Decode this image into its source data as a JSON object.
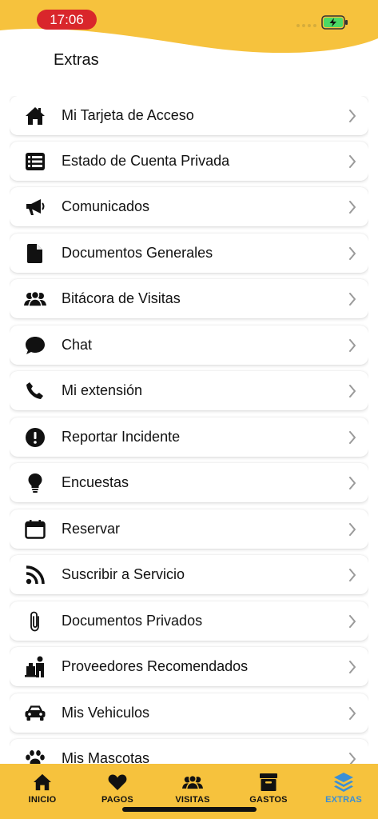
{
  "status_bar": {
    "time": "17:06"
  },
  "header": {
    "title": "Extras"
  },
  "menu": [
    {
      "label": "Mi Tarjeta de Acceso",
      "icon": "home-icon"
    },
    {
      "label": "Estado de Cuenta Privada",
      "icon": "list-icon"
    },
    {
      "label": "Comunicados",
      "icon": "megaphone-icon"
    },
    {
      "label": "Documentos Generales",
      "icon": "document-icon"
    },
    {
      "label": "Bitácora de Visitas",
      "icon": "users-icon"
    },
    {
      "label": "Chat",
      "icon": "chat-icon"
    },
    {
      "label": "Mi extensión",
      "icon": "phone-icon"
    },
    {
      "label": "Reportar Incidente",
      "icon": "alert-icon"
    },
    {
      "label": "Encuestas",
      "icon": "lightbulb-icon"
    },
    {
      "label": "Reservar",
      "icon": "calendar-icon"
    },
    {
      "label": "Suscribir a Servicio",
      "icon": "rss-icon"
    },
    {
      "label": "Documentos Privados",
      "icon": "paperclip-icon"
    },
    {
      "label": "Proveedores Recomendados",
      "icon": "supplier-icon"
    },
    {
      "label": "Mis Vehiculos",
      "icon": "car-icon"
    },
    {
      "label": "Mis Mascotas",
      "icon": "paw-icon"
    }
  ],
  "tabs": [
    {
      "label": "INICIO",
      "icon": "home-icon",
      "active": false
    },
    {
      "label": "PAGOS",
      "icon": "heart-icon",
      "active": false
    },
    {
      "label": "VISITAS",
      "icon": "users-icon",
      "active": false
    },
    {
      "label": "GASTOS",
      "icon": "archive-icon",
      "active": false
    },
    {
      "label": "EXTRAS",
      "icon": "layers-icon",
      "active": true
    }
  ],
  "colors": {
    "accent": "#f6c23d",
    "active_tab": "#3a8fd6",
    "time_pill": "#d9262b",
    "battery": "#4cd964"
  }
}
